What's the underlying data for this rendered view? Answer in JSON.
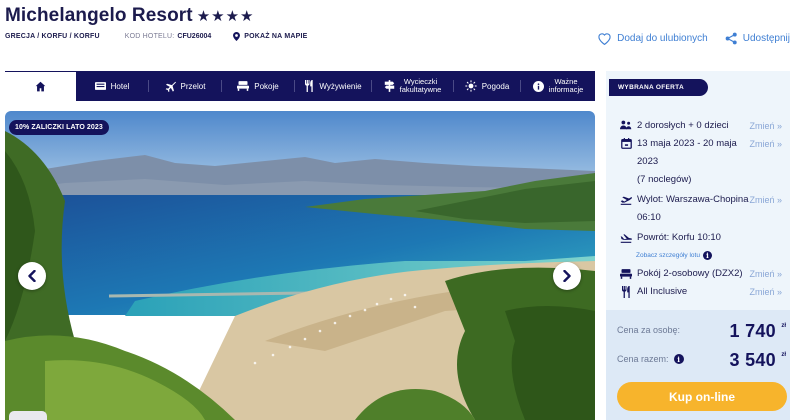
{
  "hotel": {
    "name": "Michelangelo Resort",
    "stars": "★★★★",
    "breadcrumb": "GRECJA / KORFU / KORFU",
    "code_label": "KOD HOTELU:",
    "code_value": "CFU26004",
    "map_link": "POKAŻ NA MAPIE"
  },
  "actions": {
    "favorite": "Dodaj do ulubionych",
    "share": "Udostępnij"
  },
  "nav": {
    "tabs": [
      {
        "label": "",
        "icon": "home-icon"
      },
      {
        "label": "Hotel",
        "icon": "hotel-icon"
      },
      {
        "label": "Przelot",
        "icon": "plane-icon"
      },
      {
        "label": "Pokoje",
        "icon": "bed-icon"
      },
      {
        "label": "Wyżywienie",
        "icon": "cutlery-icon"
      },
      {
        "label": "Wycieczki fakultatywne",
        "line1": "Wycieczki",
        "line2": "fakultatywne",
        "icon": "signpost-icon"
      },
      {
        "label": "Pogoda",
        "icon": "sun-icon"
      },
      {
        "label": "Ważne informacje",
        "line1": "Ważne",
        "line2": "informacje",
        "icon": "info-icon"
      }
    ]
  },
  "gallery": {
    "promo_badge": "10% ZALICZKI LATO 2023"
  },
  "offer": {
    "badge": "WYBRANA OFERTA",
    "change_label": "Zmień »",
    "guests": "2 dorosłych + 0 dzieci",
    "dates_line1": "13 maja 2023 - 20 maja",
    "dates_line2": "2023",
    "nights": "(7 noclegów)",
    "departure_line1": "Wylot: Warszawa-Chopina",
    "departure_line2": "06:10",
    "return": "Powrót: Korfu 10:10",
    "flight_details": "Zobacz szczegóły lotu",
    "room": "Pokój 2-osobowy (DZX2)",
    "board": "All Inclusive"
  },
  "prices": {
    "per_person_label": "Cena za osobę:",
    "per_person_value": "1 740",
    "total_label": "Cena razem:",
    "total_value": "3 540",
    "currency": "zł",
    "buy_button": "Kup on-line"
  },
  "colors": {
    "navy": "#14135c",
    "link_blue": "#3f7fd3",
    "buy_orange": "#f7b42c",
    "panel_bg": "#eef5fb"
  }
}
